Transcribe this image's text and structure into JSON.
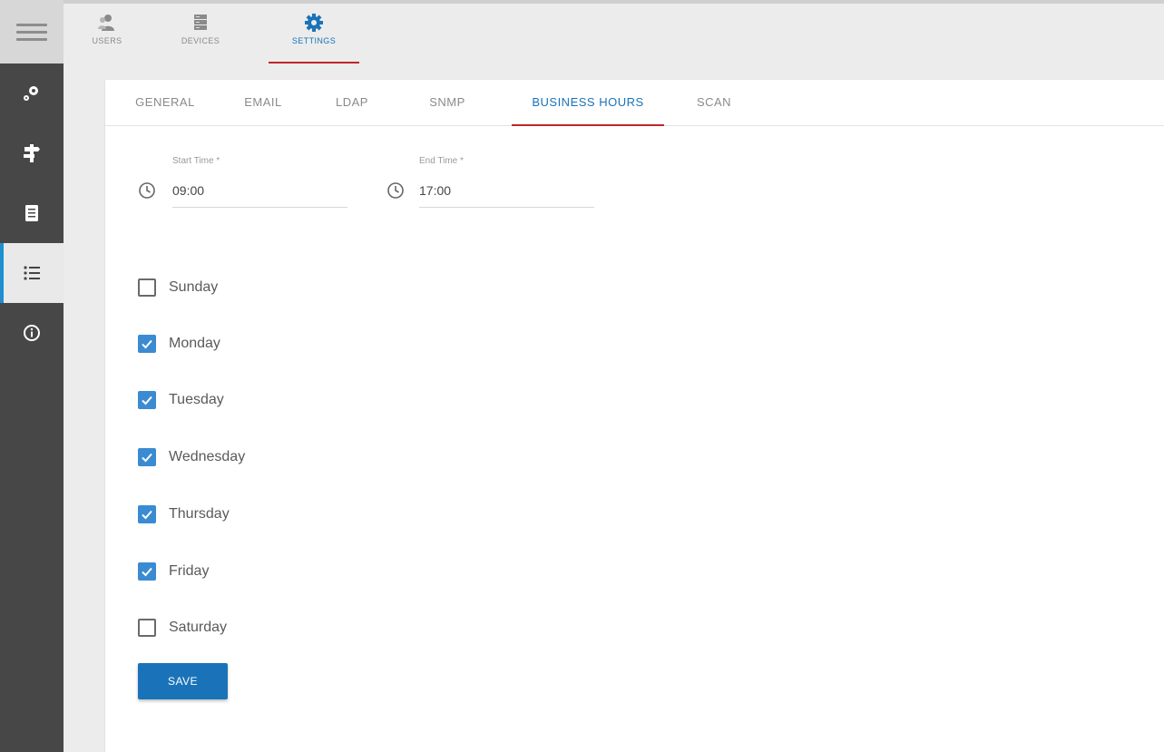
{
  "rail": {
    "menu_icon": "hamburger-icon",
    "items": [
      {
        "icon": "cluster-icon"
      },
      {
        "icon": "signpost-icon"
      },
      {
        "icon": "document-icon"
      },
      {
        "icon": "list-icon",
        "active": true
      },
      {
        "icon": "info-icon"
      }
    ]
  },
  "modules": [
    {
      "label": "USERS",
      "icon": "users-icon"
    },
    {
      "label": "DEVICES",
      "icon": "devices-icon"
    },
    {
      "label": "SETTINGS",
      "icon": "gear-icon",
      "active": true
    }
  ],
  "subtabs": [
    {
      "label": "GENERAL"
    },
    {
      "label": "EMAIL"
    },
    {
      "label": "LDAP"
    },
    {
      "label": "SNMP"
    },
    {
      "label": "BUSINESS HOURS",
      "active": true
    },
    {
      "label": "SCAN"
    }
  ],
  "start_time": {
    "label": "Start Time",
    "required_mark": "*",
    "value": "09:00"
  },
  "end_time": {
    "label": "End Time",
    "required_mark": "*",
    "value": "17:00"
  },
  "days": [
    {
      "label": "Sunday",
      "checked": false
    },
    {
      "label": "Monday",
      "checked": true
    },
    {
      "label": "Tuesday",
      "checked": true
    },
    {
      "label": "Wednesday",
      "checked": true
    },
    {
      "label": "Thursday",
      "checked": true
    },
    {
      "label": "Friday",
      "checked": true
    },
    {
      "label": "Saturday",
      "checked": false
    }
  ],
  "save_label": "SAVE",
  "colors": {
    "accent": "#1a73b8",
    "active_underline": "#c0262b",
    "checkbox": "#3a8bd1",
    "rail": "#474747"
  }
}
